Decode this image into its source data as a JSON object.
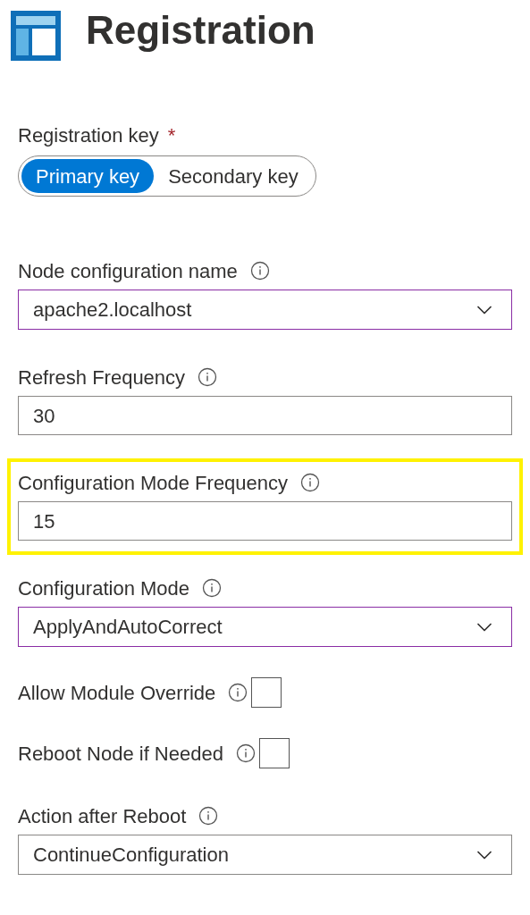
{
  "header": {
    "title": "Registration"
  },
  "registration_key": {
    "label": "Registration key",
    "required_mark": "*",
    "options": [
      {
        "label": "Primary key",
        "selected": true
      },
      {
        "label": "Secondary key",
        "selected": false
      }
    ]
  },
  "fields": [
    {
      "kind": "dropdown",
      "label": "Node configuration name",
      "value": "apache2.localhost",
      "focused": true,
      "highlighted": false
    },
    {
      "kind": "text",
      "label": "Refresh Frequency",
      "value": "30",
      "focused": false,
      "highlighted": false
    },
    {
      "kind": "text",
      "label": "Configuration Mode Frequency",
      "value": "15",
      "focused": false,
      "highlighted": true
    },
    {
      "kind": "dropdown",
      "label": "Configuration Mode",
      "value": "ApplyAndAutoCorrect",
      "focused": true,
      "highlighted": false
    },
    {
      "kind": "checkbox",
      "label": "Allow Module Override",
      "checked": false,
      "highlighted": false
    },
    {
      "kind": "checkbox",
      "label": "Reboot Node if Needed",
      "checked": false,
      "highlighted": false
    },
    {
      "kind": "dropdown",
      "label": "Action after Reboot",
      "value": "ContinueConfiguration",
      "focused": false,
      "highlighted": false
    }
  ]
}
